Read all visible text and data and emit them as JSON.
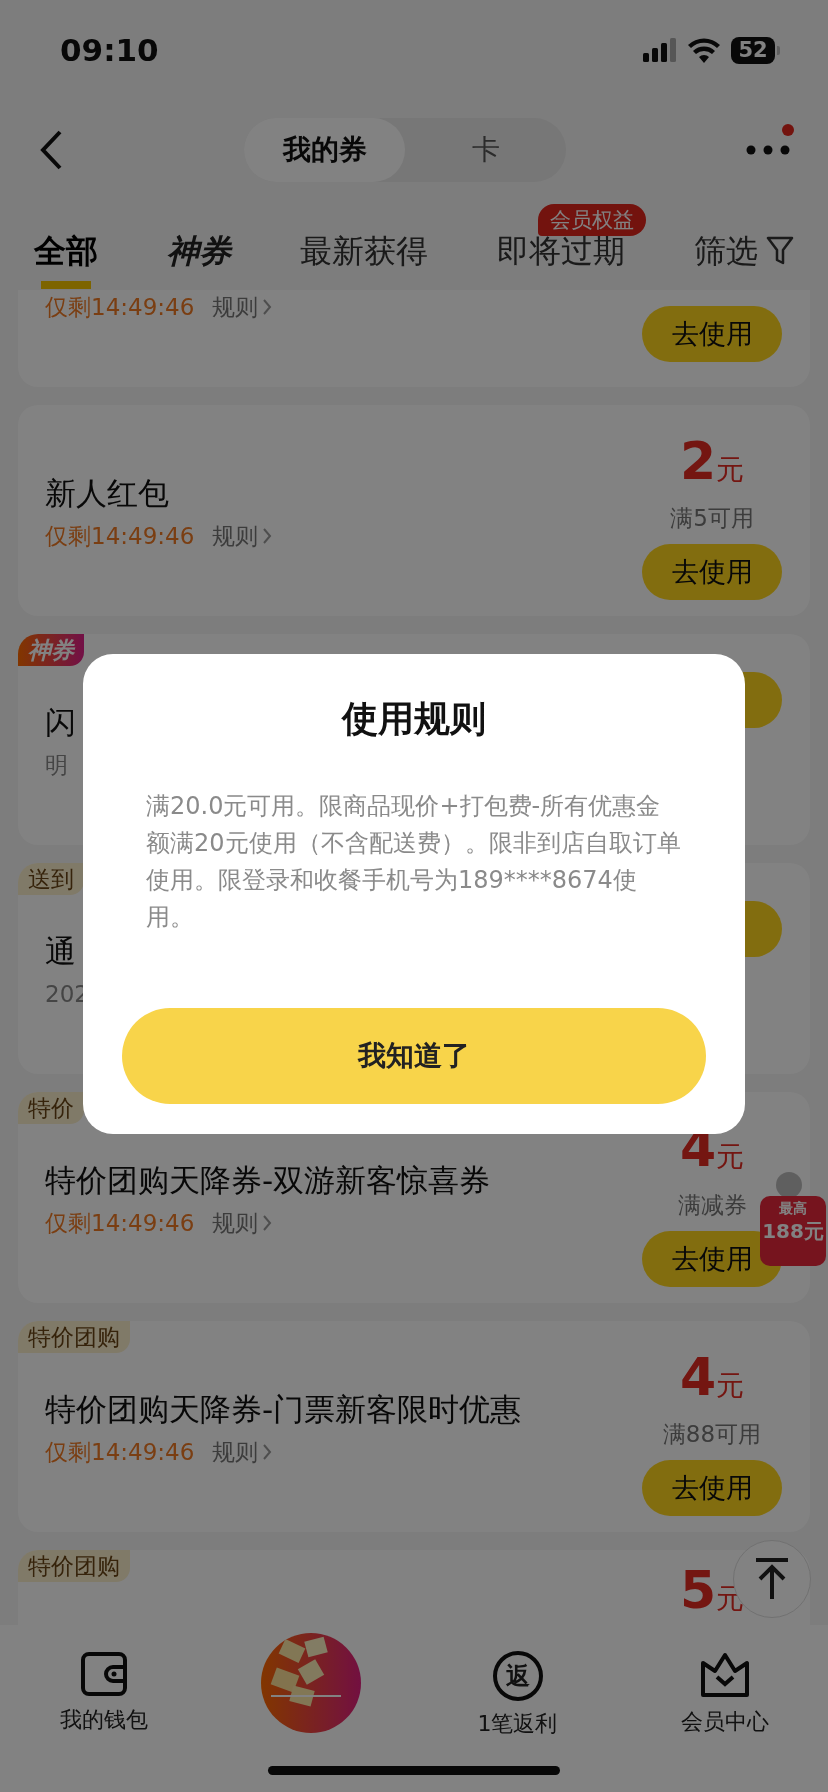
{
  "status_bar": {
    "time": "09:10",
    "battery": "52"
  },
  "nav": {
    "segments": [
      {
        "label": "我的券",
        "selected": true
      },
      {
        "label": "卡",
        "selected": false
      }
    ],
    "badge": "会员权益",
    "more_unread": true
  },
  "tabs": [
    {
      "label": "全部",
      "selected": true,
      "kind": "text"
    },
    {
      "label": "神券",
      "selected": false,
      "kind": "brand"
    },
    {
      "label": "最新获得",
      "selected": false,
      "kind": "text"
    },
    {
      "label": "即将过期",
      "selected": false,
      "kind": "text"
    },
    {
      "label": "筛选",
      "selected": false,
      "kind": "filter"
    }
  ],
  "coupons": [
    {
      "kind": "tail",
      "expiry": "仅剩14:49:46",
      "urgent": true,
      "rule": "规则",
      "button": "去使用"
    },
    {
      "kind": "full",
      "title": "新人红包",
      "expiry": "仅剩14:49:46",
      "urgent": true,
      "rule": "规则",
      "amount": "2",
      "unit": "元",
      "condition": "满5可用",
      "button": "去使用"
    },
    {
      "kind": "covered",
      "tags": [
        {
          "text": "神券",
          "kind": "brand"
        }
      ],
      "title": "闪",
      "expiry": "明",
      "urgent": false
    },
    {
      "kind": "covered",
      "tags": [
        {
          "text": "送到",
          "kind": "plain"
        }
      ],
      "title": "通",
      "expiry": "202",
      "urgent": false
    },
    {
      "kind": "full",
      "tags": [
        {
          "text": "特价",
          "kind": "plain"
        }
      ],
      "title": "特价团购天降券-双游新客惊喜券",
      "expiry": "仅剩14:49:46",
      "urgent": true,
      "rule": "规则",
      "amount": "4",
      "unit": "元",
      "condition": "满减券",
      "button": "去使用"
    },
    {
      "kind": "full",
      "tags": [
        {
          "text": "特价团购",
          "kind": "plain"
        }
      ],
      "title": "特价团购天降券-门票新客限时优惠",
      "expiry": "仅剩14:49:46",
      "urgent": true,
      "rule": "规则",
      "amount": "4",
      "unit": "元",
      "condition": "满88可用",
      "button": "去使用"
    },
    {
      "kind": "head",
      "tags": [
        {
          "text": "特价团购",
          "kind": "plain"
        }
      ],
      "amount": "5",
      "unit": "元"
    }
  ],
  "float_badge": {
    "caption": "最高",
    "amount": "188元"
  },
  "bottom_nav": [
    {
      "kind": "wallet",
      "label": "我的钱包"
    },
    {
      "kind": "picture"
    },
    {
      "kind": "rebate",
      "glyph": "返",
      "label": "1笔返利"
    },
    {
      "kind": "crown",
      "label": "会员中心"
    }
  ],
  "dialog": {
    "title": "使用规则",
    "body": "满20.0元可用。限商品现价+打包费-所有优惠金额满20元使用（不含配送费）。限非到店自取订单使用。限登录和收餐手机号为189****8674使用。",
    "button": "我知道了"
  }
}
